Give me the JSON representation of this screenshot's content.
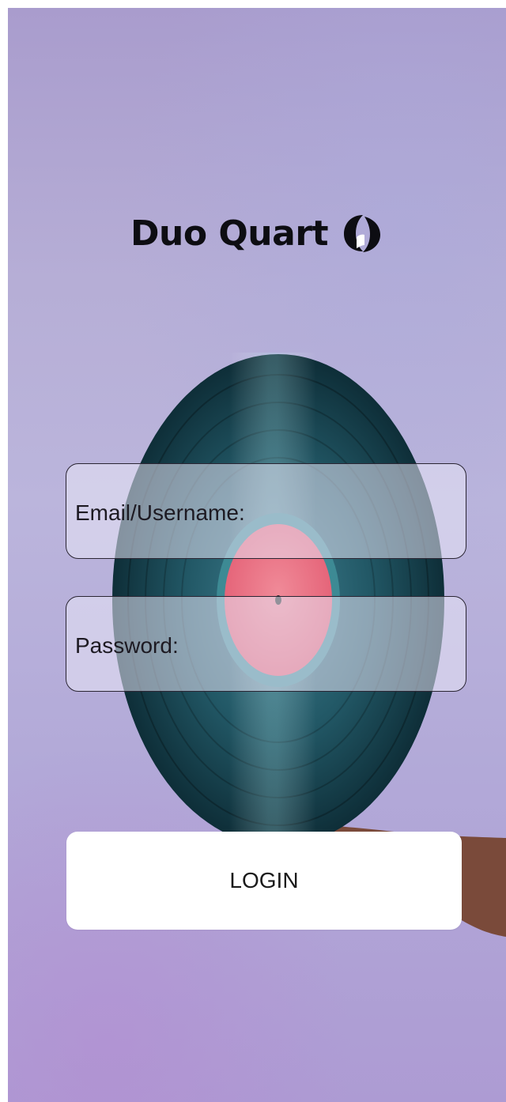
{
  "brand": {
    "name": "Duo Quart",
    "logo_icon": "record-logo-icon"
  },
  "form": {
    "email_label": "Email/Username:",
    "password_label": "Password:"
  },
  "actions": {
    "login_label": "LOGIN"
  },
  "colors": {
    "brand_text": "#0d0d12",
    "field_border": "#2a2533",
    "button_bg": "#ffffff",
    "background_top": "#a99ccd",
    "background_bottom": "#ad9bd3"
  }
}
